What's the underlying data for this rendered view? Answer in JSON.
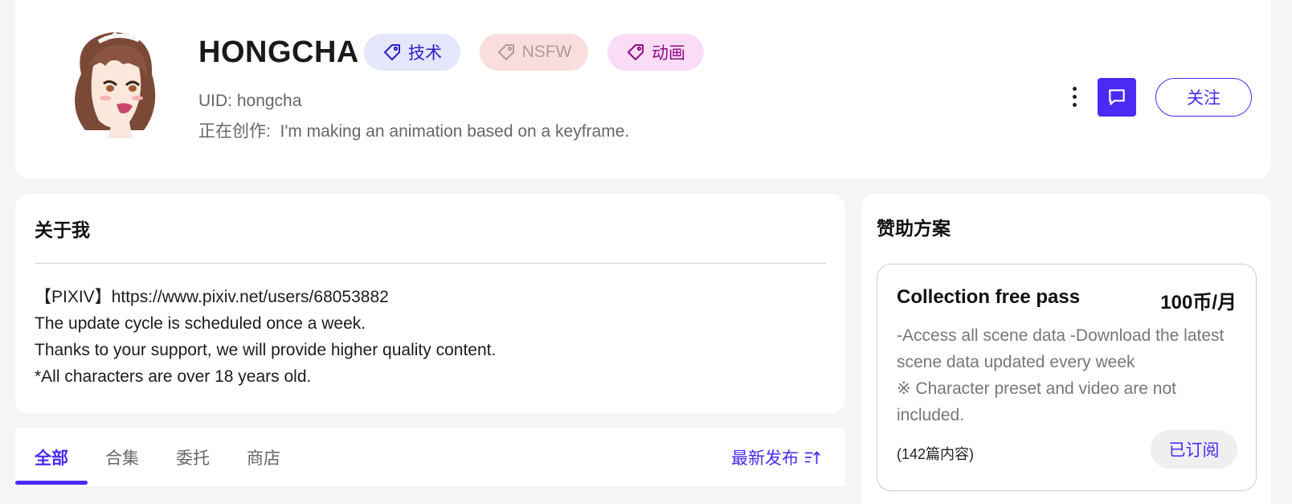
{
  "profile": {
    "name": "HONGCHA",
    "tags": [
      {
        "label": "技术",
        "icon": "tag-icon",
        "color": "#2a20c8"
      },
      {
        "label": "NSFW",
        "icon": "tag-icon",
        "color": "#b09a9a"
      },
      {
        "label": "动画",
        "icon": "tag-icon",
        "color": "#8e0e86"
      }
    ],
    "uid": "UID: hongcha",
    "creating": "正在创作:  I'm making an animation based on a keyframe.",
    "message_icon": "message-icon",
    "more_icon": "more-vertical-icon",
    "follow_label": "关注"
  },
  "about": {
    "title": "关于我",
    "lines": [
      "【PIXIV】https://www.pixiv.net/users/68053882",
      "The update cycle is scheduled once a week.",
      "Thanks to your support, we will provide higher quality content.",
      "*All characters are over 18 years old."
    ]
  },
  "tabs": {
    "items": [
      {
        "label": "全部",
        "active": true
      },
      {
        "label": "合集",
        "active": false
      },
      {
        "label": "委托",
        "active": false
      },
      {
        "label": "商店",
        "active": false
      }
    ],
    "sort_label": "最新发布",
    "sort_icon": "sort-icon"
  },
  "sponsor": {
    "title": "赞助方案",
    "plan": {
      "name": "Collection free pass",
      "price": "100币/月",
      "desc_lines": [
        "-Access all scene data -Download the latest scene data updated every week",
        "※ Character preset and video are not included."
      ],
      "count": "(142篇内容)",
      "button_label": "已订阅"
    }
  },
  "colors": {
    "accent": "#4a2bf4",
    "background": "#f5f5f7"
  }
}
